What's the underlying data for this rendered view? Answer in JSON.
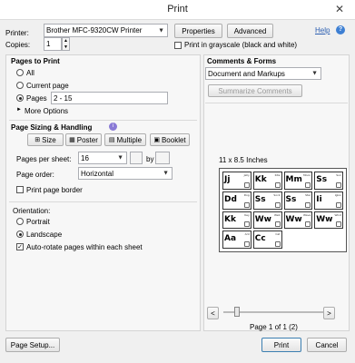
{
  "window": {
    "title": "Print",
    "close_glyph": "✕"
  },
  "printer": {
    "label": "Printer:",
    "value": "Brother MFC-9320CW Printer",
    "properties": "Properties",
    "advanced": "Advanced",
    "help": "Help",
    "help_icon": "help-icon"
  },
  "copies": {
    "label": "Copies:",
    "value": "1",
    "grayscale": "Print in grayscale (black and white)",
    "grayscale_checked": false
  },
  "pages_to_print": {
    "title": "Pages to Print",
    "all": "All",
    "current": "Current page",
    "pages": "Pages",
    "pages_value": "2 - 15",
    "selected": "pages",
    "more": "More Options"
  },
  "sizing": {
    "title": "Page Sizing & Handling",
    "buttons": [
      "Size",
      "Poster",
      "Multiple",
      "Booklet"
    ],
    "active": "Multiple",
    "pages_per_sheet_label": "Pages per sheet:",
    "pages_per_sheet_value": "16",
    "by_label": "by",
    "page_order_label": "Page order:",
    "page_order_value": "Horizontal",
    "border_label": "Print page border",
    "border_checked": false
  },
  "orientation": {
    "title": "Orientation:",
    "portrait": "Portrait",
    "landscape": "Landscape",
    "selected": "landscape",
    "autorotate": "Auto-rotate pages within each sheet",
    "autorotate_checked": true
  },
  "comments": {
    "title": "Comments & Forms",
    "value": "Document and Markups",
    "summarize": "Summarize Comments"
  },
  "preview": {
    "size_label": "11 x 8.5 Inches",
    "page_label": "Page 1 of 1 (2)",
    "prev": "<",
    "next": ">",
    "tiles": [
      {
        "letters": "Jj",
        "word": "Jelly"
      },
      {
        "letters": "Kk",
        "word": "Kite"
      },
      {
        "letters": "Mm",
        "word": "Moon"
      },
      {
        "letters": "Ss",
        "word": "Sun"
      },
      {
        "letters": "Dd",
        "word": "Dog"
      },
      {
        "letters": "Ss",
        "word": "Sock"
      },
      {
        "letters": "Ss",
        "word": "Star"
      },
      {
        "letters": "Ii",
        "word": "Igloo"
      },
      {
        "letters": "Kk",
        "word": "Key"
      },
      {
        "letters": "Ww",
        "word": "Web"
      },
      {
        "letters": "Ww",
        "word": "Wave"
      },
      {
        "letters": "Ww",
        "word": "Wind"
      },
      {
        "letters": "Aa",
        "word": "Ant"
      },
      {
        "letters": "Cc",
        "word": "Cat"
      }
    ]
  },
  "footer": {
    "page_setup": "Page Setup...",
    "print": "Print",
    "cancel": "Cancel"
  }
}
